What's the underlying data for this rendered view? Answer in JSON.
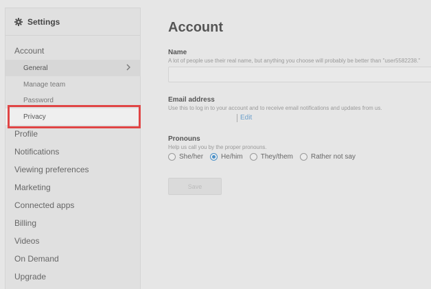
{
  "sidebar": {
    "header": {
      "icon": "gear-icon",
      "title": "Settings"
    },
    "account": {
      "label": "Account",
      "items": [
        {
          "label": "General",
          "icon": "chevron-right-icon",
          "active": true
        },
        {
          "label": "Manage team"
        },
        {
          "label": "Password"
        },
        {
          "label": "Privacy",
          "highlighted": true
        }
      ]
    },
    "sections": [
      "Profile",
      "Notifications",
      "Viewing preferences",
      "Marketing",
      "Connected apps",
      "Billing",
      "Videos",
      "On Demand",
      "Upgrade"
    ]
  },
  "main": {
    "title": "Account",
    "name": {
      "label": "Name",
      "help": "A lot of people use their real name, but anything you choose will probably be better than \"user5582238.\"",
      "value": ""
    },
    "email": {
      "label": "Email address",
      "help": "Use this to log in to your account and to receive email notifications and updates from us.",
      "edit_label": "Edit"
    },
    "pronouns": {
      "label": "Pronouns",
      "help": "Help us call you by the proper pronouns.",
      "options": [
        "She/her",
        "He/him",
        "They/them",
        "Rather not say"
      ],
      "selected": "He/him"
    },
    "save_label": "Save"
  },
  "colors": {
    "highlight": "#e04545",
    "link": "#6a9fcb",
    "radio_selected": "#4a90c8"
  }
}
